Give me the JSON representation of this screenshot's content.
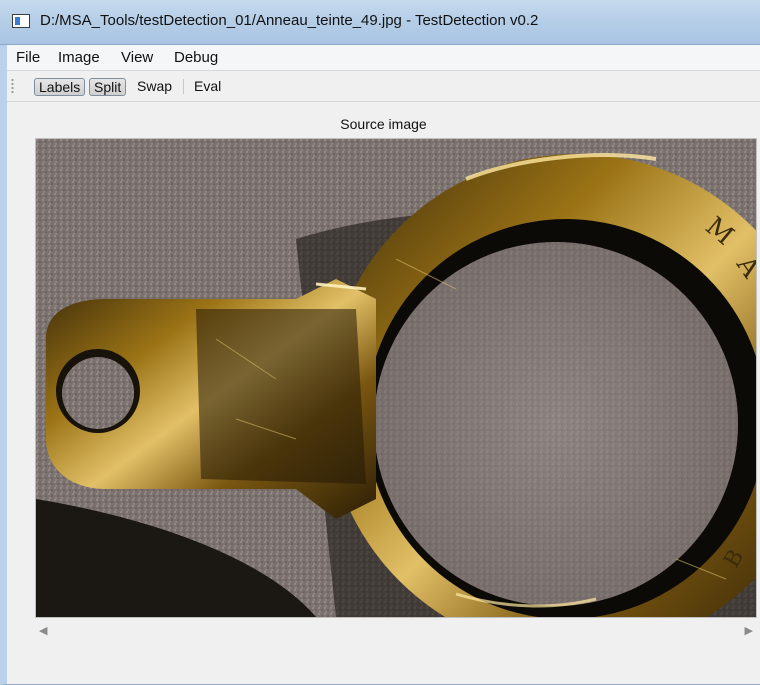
{
  "window": {
    "title": "D:/MSA_Tools/testDetection_01/Anneau_teinte_49.jpg - TestDetection v0.2"
  },
  "menu": {
    "items": [
      "File",
      "Image",
      "View",
      "Debug"
    ]
  },
  "toolbar": {
    "labels_label": "Labels",
    "split_label": "Split",
    "swap_label": "Swap",
    "eval_label": "Eval"
  },
  "viewer": {
    "caption": "Source image"
  },
  "colors": {
    "gold": "#c79a2a",
    "carpet": "#7d7370"
  },
  "icons": {
    "app": "app-window-icon",
    "scroll_left": "chevron-left-icon",
    "scroll_right": "chevron-right-icon"
  }
}
